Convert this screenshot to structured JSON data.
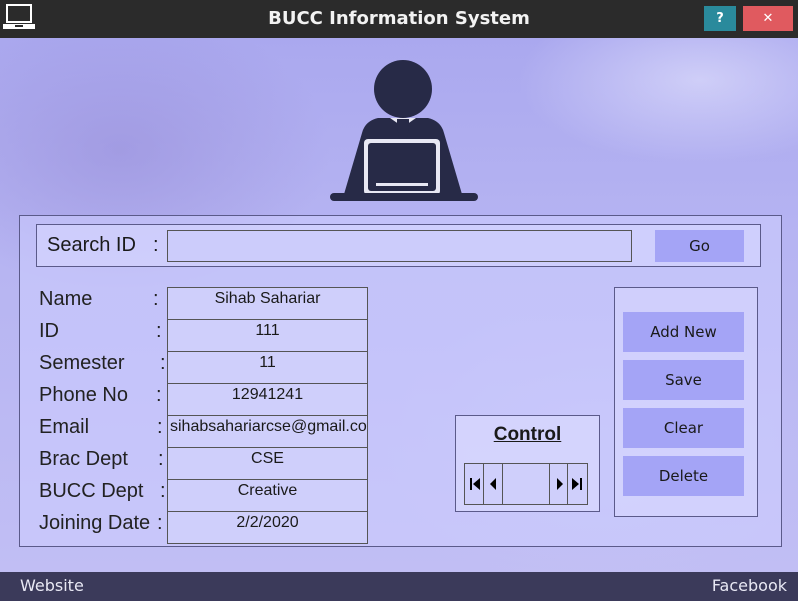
{
  "window": {
    "title": "BUCC Information System",
    "help_label": "?",
    "close_label": "✕"
  },
  "search": {
    "label": "Search ID",
    "colon": ":",
    "value": "",
    "go_label": "Go"
  },
  "form": {
    "fields": [
      {
        "label": "Name",
        "value": "Sihab Sahariar"
      },
      {
        "label": "ID",
        "value": "111"
      },
      {
        "label": "Semester",
        "value": "11"
      },
      {
        "label": "Phone No",
        "value": "12941241"
      },
      {
        "label": "Email",
        "value": "sihabsahariarcse@gmail.com"
      },
      {
        "label": "Brac Dept",
        "value": "CSE"
      },
      {
        "label": "BUCC Dept",
        "value": "Creative"
      },
      {
        "label": "Joining Date",
        "value": "2/2/2020"
      }
    ],
    "colon": ":"
  },
  "control": {
    "title": "Control",
    "first_icon": "skip-first-icon",
    "prev_icon": "prev-icon",
    "next_icon": "next-icon",
    "last_icon": "skip-last-icon",
    "position_value": ""
  },
  "actions": {
    "add_new": "Add New",
    "save": "Save",
    "clear": "Clear",
    "delete": "Delete"
  },
  "footer": {
    "website": "Website",
    "facebook": "Facebook"
  },
  "colors": {
    "titlebar": "#2b2b2b",
    "help_button": "#2a8a9c",
    "close_button": "#e05a5f",
    "button": "#a4a4f6",
    "footer": "#3b3a5a"
  }
}
